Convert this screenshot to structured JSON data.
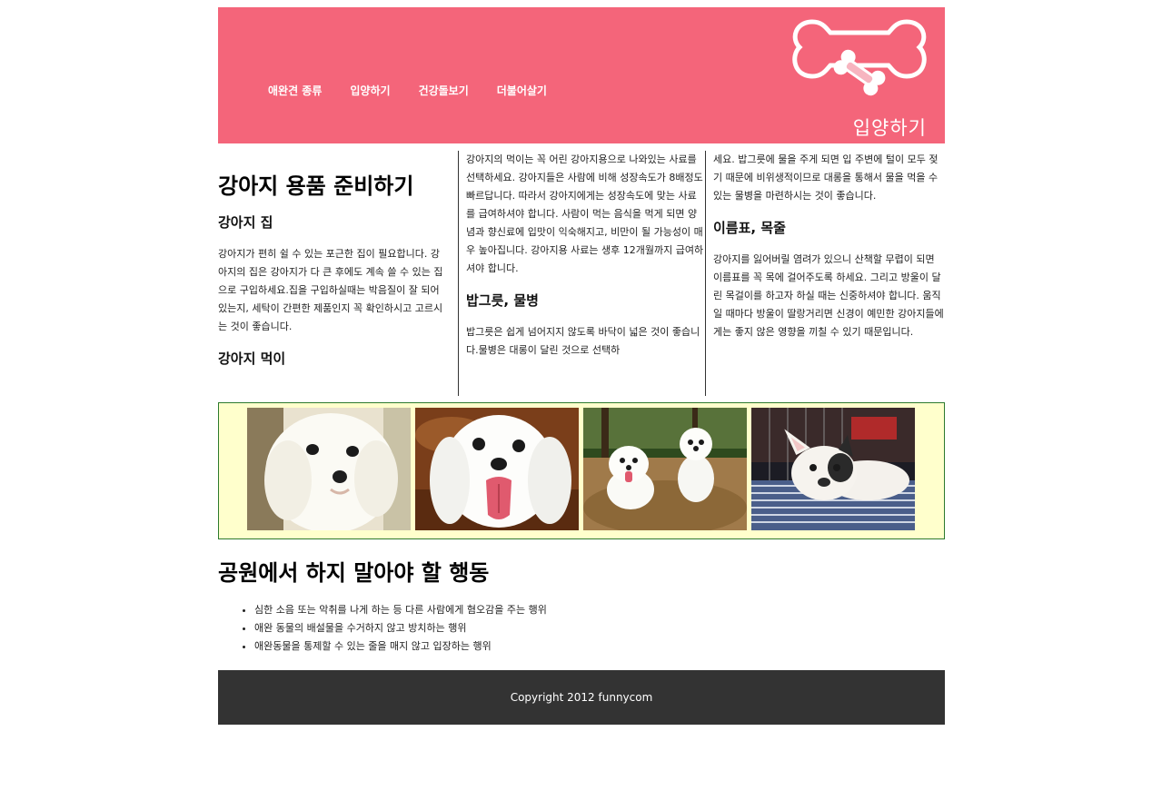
{
  "header": {
    "nav": [
      "애완견 종류",
      "입양하기",
      "건강돌보기",
      "더불어살기"
    ],
    "logo_text": "입양하기",
    "bg_color": "#f4657a"
  },
  "article": {
    "title": "강아지 용품 준비하기",
    "sections": [
      {
        "heading": "강아지 집",
        "text": "강아지가 편히 쉴 수 있는 포근한 집이 필요합니다. 강아지의 집은 강아지가 다 큰 후에도 계속 쓸 수 있는 집으로 구입하세요.집을 구입하실때는 박음질이 잘 되어 있는지, 세탁이 간편한 제품인지 꼭 확인하시고 고르시는 것이 좋습니다."
      },
      {
        "heading": "강아지 먹이",
        "text": "강아지의 먹이는 꼭 어린 강아지용으로 나와있는 사료를 선택하세요. 강아지들은 사람에 비해 성장속도가 8배정도 빠르답니다. 따라서 강아지에게는 성장속도에 맞는 사료를 급여하셔야 합니다. 사람이 먹는 음식을 먹게 되면 양념과 향신료에 입맛이 익숙해지고, 비만이 될 가능성이 매우 높아집니다. 강아지용 사료는 생후 12개월까지 급여하셔야 합니다."
      },
      {
        "heading": "밥그릇, 물병",
        "text": "밥그릇은 쉽게 넘어지지 않도록 바닥이 넓은 것이 좋습니다.물병은 대롱이 달린 것으로 선택하세요. 밥그릇에 물을 주게 되면 입 주변에 털이 모두 젖기 때문에 비위생적이므로 대롱을 통해서 물을 먹을 수 있는 물병을 마련하시는 것이 좋습니다."
      },
      {
        "heading": "이름표, 목줄",
        "text": "강아지를 잃어버릴 염려가 있으니 산책할 무렵이 되면 이름표를 꼭 목에 걸어주도록 하세요. 그리고 방울이 달린 목걸이를 하고자 하실 때는 신중하셔야 합니다. 움직일 때마다 방울이 딸랑거리면 신경이 예민한 강아지들에게는 좋지 않은 영향을 끼칠 수 있기 때문입니다."
      }
    ],
    "col2_continuation_a": "강아지의 먹이는 꼭 어린 강아지용으로 나와있는 사료를 선택하세요. 강아지들은 사람에 비해 성장속도가 8배정도 빠르답니다. 따라서 강아지에게는 성장속도에 맞는 사료를 급여하셔야 합니다. 사람이 먹는 음식을 먹게 되면 양념과 향신료에 입맛이 익숙해지고, 비만이 될 가능성이 매우 높아집니다. 강아지용 사료는 생후 12개월까지 급여하셔야 합니다.",
    "col2_continuation_b": "밥그릇은 쉽게 넘어지지 않도록 바닥이 넓은 것이 좋습니다.물병은 대롱이 달린 것으로 선택하",
    "col3_continuation": "세요. 밥그릇에 물을 주게 되면 입 주변에 털이 모두 젖기 때문에 비위생적이므로 대롱을 통해서 물을 먹을 수 있는 물병을 마련하시는 것이 좋습니다."
  },
  "gallery": {
    "photos": [
      "white-puppy-photo",
      "maltese-tongue-photo",
      "two-white-dogs-photo",
      "french-bulldog-photo"
    ],
    "bg_color": "#ffffcc",
    "border_color": "#2d7a2d"
  },
  "rules": {
    "title": "공원에서 하지 말아야 할 행동",
    "items": [
      "심한 소음 또는 악취를 나게 하는 등 다른 사람에게 혐오감을 주는 행위",
      "애완 동물의 배설물을 수거하지 않고 방치하는 행위",
      "애완동물을 통제할 수 있는 줄을 매지 않고 입장하는 행위"
    ]
  },
  "footer": {
    "text": "Copyright 2012 funnycom",
    "bg_color": "#333333"
  }
}
